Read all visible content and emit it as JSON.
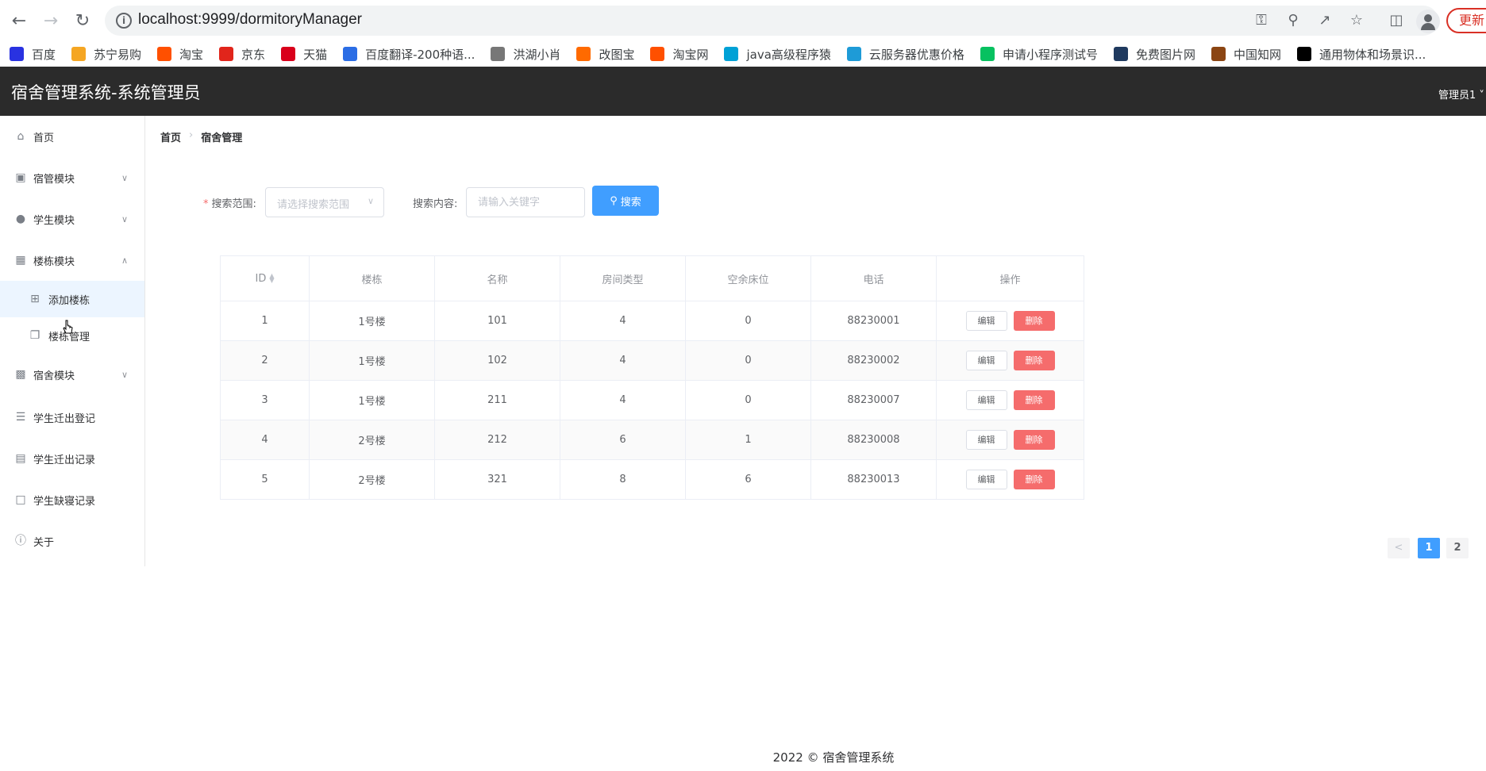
{
  "browser": {
    "url": "localhost:9999/dormitoryManager",
    "update_label": "更新",
    "bookmarks": [
      {
        "label": "百度",
        "color": "#2932e1"
      },
      {
        "label": "苏宁易购",
        "color": "#f5a623"
      },
      {
        "label": "淘宝",
        "color": "#ff5000"
      },
      {
        "label": "京东",
        "color": "#e1251b"
      },
      {
        "label": "天猫",
        "color": "#d9001b"
      },
      {
        "label": "百度翻译-200种语...",
        "color": "#2b6de5"
      },
      {
        "label": "洪湖小肖",
        "color": "#777777"
      },
      {
        "label": "改图宝",
        "color": "#ff6a00"
      },
      {
        "label": "淘宝网",
        "color": "#ff5000"
      },
      {
        "label": "java高级程序猿",
        "color": "#00a1d6"
      },
      {
        "label": "云服务器优惠价格",
        "color": "#1e9bd7"
      },
      {
        "label": "申请小程序测试号",
        "color": "#07c160"
      },
      {
        "label": "免费图片网",
        "color": "#1f3a5f"
      },
      {
        "label": "中国知网",
        "color": "#8b4513"
      },
      {
        "label": "通用物体和场景识...",
        "color": "#000000"
      }
    ]
  },
  "header": {
    "title": "宿舍管理系统-系统管理员",
    "admin_label": "管理员1"
  },
  "sidebar": {
    "items": [
      {
        "label": "首页",
        "icon": "home-icon"
      },
      {
        "label": "宿管模块",
        "icon": "monitor-icon"
      },
      {
        "label": "学生模块",
        "icon": "user-icon"
      },
      {
        "label": "楼栋模块",
        "icon": "building-icon"
      },
      {
        "label": "添加楼栋",
        "icon": "folder-add-icon"
      },
      {
        "label": "楼栋管理",
        "icon": "document-copy-icon"
      },
      {
        "label": "宿舍模块",
        "icon": "office-icon"
      },
      {
        "label": "学生迁出登记",
        "icon": "list-icon"
      },
      {
        "label": "学生迁出记录",
        "icon": "clipboard-icon"
      },
      {
        "label": "学生缺寝记录",
        "icon": "document-icon"
      },
      {
        "label": "关于",
        "icon": "info-icon"
      }
    ]
  },
  "breadcrumb": {
    "home": "首页",
    "current": "宿舍管理"
  },
  "search": {
    "scope_label": "搜索范围:",
    "scope_placeholder": "请选择搜索范围",
    "content_label": "搜索内容:",
    "content_placeholder": "请输入关键字",
    "button_label": "搜索"
  },
  "table": {
    "columns": [
      "ID",
      "楼栋",
      "名称",
      "房间类型",
      "空余床位",
      "电话",
      "操作"
    ],
    "edit_label": "编辑",
    "delete_label": "删除",
    "rows": [
      {
        "id": "1",
        "building": "1号楼",
        "name": "101",
        "type": "4",
        "free": "0",
        "phone": "88230001"
      },
      {
        "id": "2",
        "building": "1号楼",
        "name": "102",
        "type": "4",
        "free": "0",
        "phone": "88230002"
      },
      {
        "id": "3",
        "building": "1号楼",
        "name": "211",
        "type": "4",
        "free": "0",
        "phone": "88230007"
      },
      {
        "id": "4",
        "building": "2号楼",
        "name": "212",
        "type": "6",
        "free": "1",
        "phone": "88230008"
      },
      {
        "id": "5",
        "building": "2号楼",
        "name": "321",
        "type": "8",
        "free": "6",
        "phone": "88230013"
      }
    ]
  },
  "pagination": {
    "prev": "<",
    "pages": [
      "1",
      "2"
    ],
    "current": "1"
  },
  "footer": {
    "text": "2022 © 宿舍管理系统"
  },
  "colors": {
    "primary": "#409eff",
    "danger": "#f56c6c",
    "header_bg": "#2b2b2b"
  }
}
